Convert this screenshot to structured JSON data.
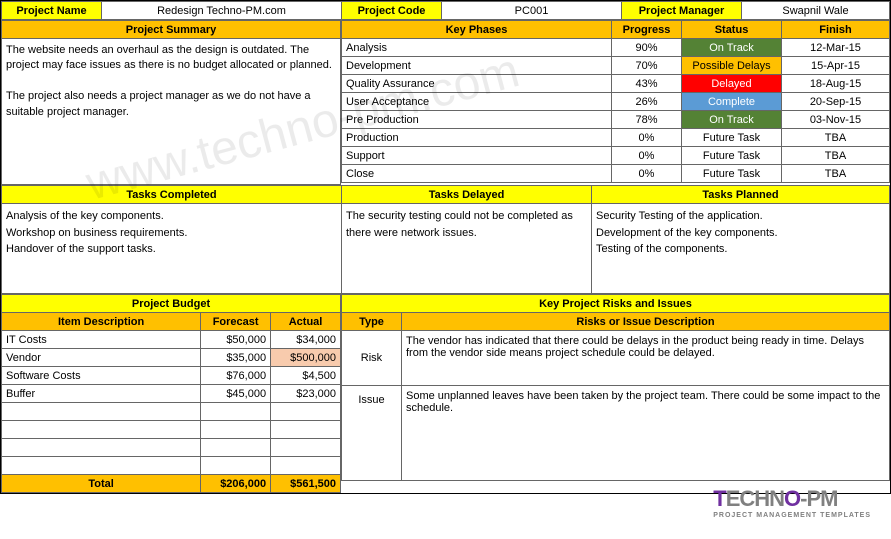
{
  "header": {
    "project_name_label": "Project Name",
    "project_name": "Redesign Techno-PM.com",
    "project_code_label": "Project Code",
    "project_code": "PC001",
    "project_manager_label": "Project Manager",
    "project_manager": "Swapnil Wale"
  },
  "summary": {
    "title": "Project Summary",
    "text1": "The website needs an overhaul as the design is outdated. The project may face issues as there is no budget allocated or planned.",
    "text2": "The project also needs a project manager as we do not have a suitable project manager."
  },
  "phases": {
    "title": "Key Phases",
    "progress_hdr": "Progress",
    "status_hdr": "Status",
    "finish_hdr": "Finish",
    "rows": [
      {
        "name": "Analysis",
        "progress": "90%",
        "status": "On Track",
        "status_class": "on-track",
        "finish": "12-Mar-15"
      },
      {
        "name": "Development",
        "progress": "70%",
        "status": "Possible Delays",
        "status_class": "possible",
        "finish": "15-Apr-15"
      },
      {
        "name": "Quality Assurance",
        "progress": "43%",
        "status": "Delayed",
        "status_class": "delayed",
        "finish": "18-Aug-15"
      },
      {
        "name": "User Acceptance",
        "progress": "26%",
        "status": "Complete",
        "status_class": "complete",
        "finish": "20-Sep-15"
      },
      {
        "name": "Pre Production",
        "progress": "78%",
        "status": "On Track",
        "status_class": "on-track",
        "finish": "03-Nov-15"
      },
      {
        "name": "Production",
        "progress": "0%",
        "status": "Future Task",
        "status_class": "future",
        "finish": "TBA"
      },
      {
        "name": "Support",
        "progress": "0%",
        "status": "Future Task",
        "status_class": "future",
        "finish": "TBA"
      },
      {
        "name": "Close",
        "progress": "0%",
        "status": "Future Task",
        "status_class": "future",
        "finish": "TBA"
      }
    ]
  },
  "tasks": {
    "completed_hdr": "Tasks Completed",
    "completed_1": "Analysis of the key components.",
    "completed_2": "Workshop on business requirements.",
    "completed_3": "Handover of the support tasks.",
    "delayed_hdr": "Tasks Delayed",
    "delayed_1": "The security testing could not be completed as there were network issues.",
    "planned_hdr": "Tasks Planned",
    "planned_1": "Security Testing of the application.",
    "planned_2": "Development of the key components.",
    "planned_3": "Testing of the components."
  },
  "budget": {
    "title": "Project Budget",
    "item_hdr": "Item Description",
    "forecast_hdr": "Forecast",
    "actual_hdr": "Actual",
    "rows": [
      {
        "item": "IT Costs",
        "forecast": "$50,000",
        "actual": "$34,000",
        "actual_class": ""
      },
      {
        "item": "Vendor",
        "forecast": "$35,000",
        "actual": "$500,000",
        "actual_class": "pink"
      },
      {
        "item": "Software Costs",
        "forecast": "$76,000",
        "actual": "$4,500",
        "actual_class": ""
      },
      {
        "item": "Buffer",
        "forecast": "$45,000",
        "actual": "$23,000",
        "actual_class": ""
      }
    ],
    "total_label": "Total",
    "total_forecast": "$206,000",
    "total_actual": "$561,500"
  },
  "risks": {
    "title_key": "Key",
    "title_rest": " Project Risks and Issues",
    "type_hdr": "Type",
    "desc_hdr": "Risks or Issue Description",
    "r1_type": "Risk",
    "r1_desc": "The vendor has indicated that there could be delays in the product being ready in time. Delays from the vendor side means project schedule could be delayed.",
    "r2_type": "Issue",
    "r2_desc": "Some unplanned leaves have been taken by the project team. There could be some impact to the schedule."
  },
  "watermark": "www.techno-pm.com",
  "logo": {
    "t": "T",
    "rest": "ECHN",
    "o": "O",
    "pm": "-PM",
    "sub": "PROJECT MANAGEMENT TEMPLATES"
  }
}
